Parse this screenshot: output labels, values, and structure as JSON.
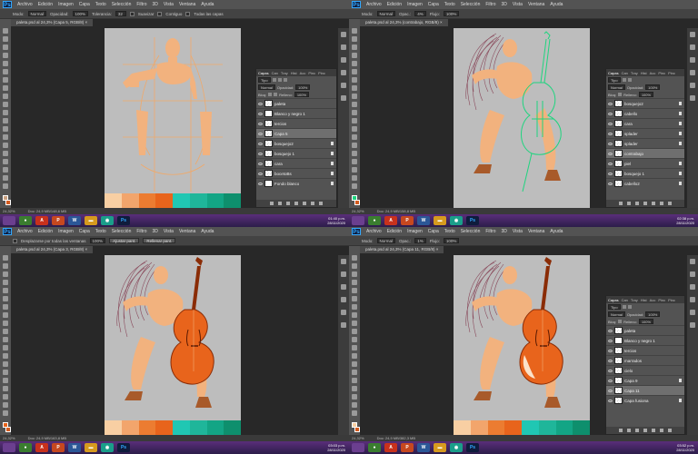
{
  "menu": [
    "Archivo",
    "Edición",
    "Imagen",
    "Capa",
    "Texto",
    "Selección",
    "Filtro",
    "3D",
    "Vista",
    "Ventana",
    "Ayuda"
  ],
  "ps_logo": "Ps",
  "colors": {
    "skin": "#f2b27e",
    "skin_light": "#f8cfa3",
    "sketch": "#f0a96a",
    "hair": "#8a4a5c",
    "green_line": "#1fd47f",
    "cello": "#e8641c",
    "cello_dark": "#8a2c06",
    "canvas_bg": "#bdbdbd",
    "palette": [
      "#f8cfa3",
      "#f2a56c",
      "#ec7c31",
      "#e8641c",
      "#20c7b3",
      "#1fb69a",
      "#13a585",
      "#0e8f6d"
    ]
  },
  "quadrants": {
    "tl": {
      "options": {
        "mode_label": "Modo:",
        "mode_value": "Normal",
        "opacity_label": "Opacidad:",
        "opacity_value": "100%",
        "tolerance_label": "Tolerancia:",
        "tolerance_value": "32",
        "smooth_label": "Suavizar",
        "contiguous_label": "Contiguo",
        "all_layers_label": "Todas las capas"
      },
      "doc_tab": "paleta.psd al 24,3% (Capa 5, RGB/8) ×",
      "status": {
        "zoom": "24,32%",
        "doc": "Doc: 24,9 MB/148,6 MB"
      },
      "clock": {
        "time": "01:40 p.m.",
        "date": "28/11/2020"
      },
      "panel": {
        "tabs": [
          "Capas",
          "Can",
          "Tray",
          "Hist",
          "Acc",
          "Pinc",
          "Pinc"
        ],
        "kind": "Tipo",
        "blend": "Normal",
        "opacity_label": "Opacidad:",
        "opacity": "100%",
        "lock_label": "Bloq:",
        "fill_label": "Relleno:",
        "fill": "100%",
        "layers": [
          {
            "name": "paleta",
            "thumb": "checker",
            "selected": false
          },
          {
            "name": "Blanco y negro 1",
            "thumb": "white",
            "selected": false
          },
          {
            "name": "tercios",
            "thumb": "checker",
            "selected": false
          },
          {
            "name": "Capa 5",
            "thumb": "checker",
            "selected": true
          },
          {
            "name": "bosquejo2",
            "thumb": "checker",
            "selected": false
          },
          {
            "name": "bosquejo 1",
            "thumb": "checker",
            "selected": false
          },
          {
            "name": "cara",
            "thumb": "checker",
            "selected": false
          },
          {
            "name": "bocetoBs",
            "thumb": "checker",
            "selected": false
          },
          {
            "name": "Fondo blanco",
            "thumb": "white",
            "selected": false
          }
        ]
      }
    },
    "tr": {
      "options": {
        "mode_label": "Modo:",
        "mode_value": "Normal",
        "opacity_label": "Opac.:",
        "opacity_value": "4%",
        "flow_label": "Flujo:",
        "flow_value": "100%"
      },
      "doc_tab": "paleta.psd al 24,3% (contrabajo, RGB/8) ×",
      "status": {
        "zoom": "24,32%",
        "doc": "Doc: 24,9 MB/158,8 MB"
      },
      "clock": {
        "time": "02:38 p.m.",
        "date": "28/11/2020"
      },
      "panel": {
        "tabs": [
          "Capas",
          "Can",
          "Tray",
          "Hist",
          "Acc",
          "Pinc",
          "Pinc"
        ],
        "kind": "Tipo",
        "blend": "Normal",
        "opacity_label": "Opacidad:",
        "opacity": "100%",
        "lock_label": "Bloq:",
        "fill_label": "Relleno:",
        "fill": "100%",
        "layers": [
          {
            "name": "bosquejo2",
            "thumb": "checker",
            "selected": false
          },
          {
            "name": "cabello",
            "thumb": "checker",
            "selected": false
          },
          {
            "name": "cara",
            "thumb": "checker",
            "selected": false
          },
          {
            "name": "splader",
            "thumb": "checker",
            "selected": false
          },
          {
            "name": "splader",
            "thumb": "checker",
            "selected": false
          },
          {
            "name": "contrabajo",
            "thumb": "checker",
            "selected": true
          },
          {
            "name": "piel",
            "thumb": "checker",
            "selected": false
          },
          {
            "name": "bosquejo 1",
            "thumb": "checker",
            "selected": false
          },
          {
            "name": "cabello2",
            "thumb": "checker",
            "selected": false
          }
        ]
      }
    },
    "bl": {
      "options": {
        "scroll_all_label": "Desplazarse por todas las ventanas",
        "zoom_value": "100%",
        "fit_label": "Ajustar pant.",
        "fill_label": "Rellenar pant."
      },
      "doc_tab": "paleta.psd al 24,3% (Capa 3, RGB/8) ×",
      "status": {
        "zoom": "24,32%",
        "doc": "Doc: 24,9 MB/163,8 MB"
      },
      "clock": {
        "time": "03:03 p.m.",
        "date": "28/11/2020"
      }
    },
    "br": {
      "options": {
        "mode_label": "Modo:",
        "mode_value": "Normal",
        "opacity_label": "Opac.:",
        "opacity_value": "1%",
        "flow_label": "Flujo:",
        "flow_value": "100%"
      },
      "doc_tab": "paleta.psd al 24,3% (Capa 11, RGB/8) ×",
      "status": {
        "zoom": "24,32%",
        "doc": "Doc: 24,9 MB/382,3 MB"
      },
      "clock": {
        "time": "03:52 p.m.",
        "date": "28/11/2020"
      },
      "panel": {
        "tabs": [
          "Capas",
          "Can",
          "Tray",
          "Hist",
          "Acc",
          "Pinc",
          "Pinc"
        ],
        "kind": "Tipo",
        "blend": "Normal",
        "opacity_label": "Opacidad:",
        "opacity": "100%",
        "lock_label": "Bloq:",
        "fill_label": "Relleno:",
        "fill": "100%",
        "layers": [
          {
            "name": "paleta",
            "thumb": "checker",
            "selected": false
          },
          {
            "name": "Blanco y negro 1",
            "thumb": "white",
            "selected": false
          },
          {
            "name": "tercios",
            "thumb": "checker",
            "selected": false
          },
          {
            "name": "marrados",
            "thumb": "checker",
            "selected": false
          },
          {
            "name": "cielo",
            "thumb": "checker",
            "selected": false
          },
          {
            "name": "Capa 9",
            "thumb": "checker",
            "selected": false
          },
          {
            "name": "Capa 11",
            "thumb": "checker",
            "selected": true
          },
          {
            "name": "Capa fusiona",
            "thumb": "checker",
            "selected": false
          }
        ]
      }
    }
  },
  "taskbar_apps": [
    {
      "icon": "start-icon",
      "color": "#6b3f8f",
      "glyph": ""
    },
    {
      "icon": "chrome-icon",
      "color": "#3a7d2f",
      "glyph": "●"
    },
    {
      "icon": "pdf-icon",
      "color": "#c8311c",
      "glyph": "A"
    },
    {
      "icon": "powerpoint-icon",
      "color": "#c6481f",
      "glyph": "P"
    },
    {
      "icon": "word-icon",
      "color": "#2b5797",
      "glyph": "W"
    },
    {
      "icon": "explorer-icon",
      "color": "#d69a1e",
      "glyph": "▬"
    },
    {
      "icon": "camera-icon",
      "color": "#1a9e8a",
      "glyph": "◉"
    },
    {
      "icon": "photoshop-icon",
      "color": "#0f1c3c",
      "glyph": "Ps"
    }
  ]
}
